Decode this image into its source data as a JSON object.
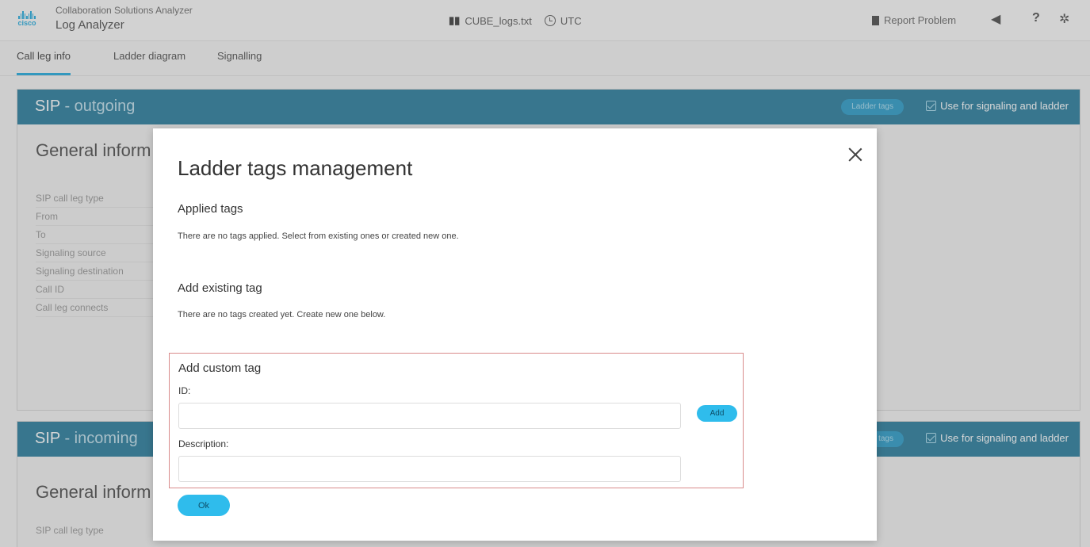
{
  "header": {
    "logo_text": "cisco",
    "app_subtitle": "Collaboration Solutions Analyzer",
    "app_title": "Log Analyzer",
    "file_name": "CUBE_logs.txt",
    "timezone": "UTC",
    "report_problem": "Report Problem",
    "icons": [
      "bar-chart-icon",
      "clock-icon",
      "document-icon",
      "megaphone-icon",
      "help-icon",
      "gear-icon"
    ]
  },
  "tabs": [
    {
      "label": "Call leg info",
      "active": true
    },
    {
      "label": "Ladder diagram",
      "active": false
    },
    {
      "label": "Signalling",
      "active": false
    }
  ],
  "panels": [
    {
      "title": "SIP",
      "suffix": "- outgoing",
      "ladder_tags_label": "Ladder tags",
      "use_for_label": "Use for signaling and ladder",
      "general_info": "General inform",
      "fields": [
        "SIP call leg type",
        "From",
        "To",
        "Signaling source",
        "Signaling destination",
        "Call ID",
        "Call leg connects"
      ]
    },
    {
      "title": "SIP",
      "suffix": "- incoming",
      "ladder_tags_label": "Ladder tags",
      "use_for_label": "Use for signaling and ladder",
      "general_info": "General inform",
      "fields": [
        "SIP call leg type"
      ]
    }
  ],
  "modal": {
    "title": "Ladder tags management",
    "applied_title": "Applied tags",
    "applied_text": "There are no tags applied. Select from existing ones or created new one.",
    "existing_title": "Add existing tag",
    "existing_text": "There are no tags created yet. Create new one below.",
    "custom_title": "Add custom tag",
    "id_label": "ID:",
    "id_value": "",
    "description_label": "Description:",
    "description_value": "",
    "add_label": "Add",
    "ok_label": "Ok"
  },
  "colors": {
    "panel_header": "#0c6a8f",
    "accent": "#049fd9",
    "button": "#2fbcec",
    "highlight_border": "#d98b8b"
  }
}
